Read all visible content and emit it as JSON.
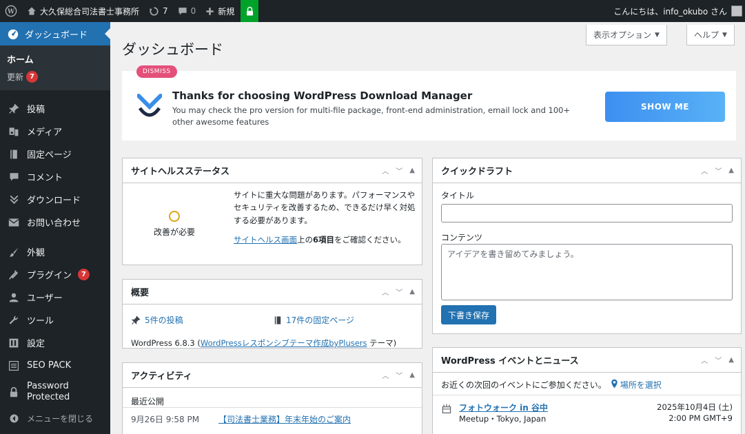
{
  "adminbar": {
    "site_name": "大久保総合司法書士事務所",
    "updates_count": "7",
    "comments_count": "0",
    "new_label": "新規",
    "greeting": "こんにちは、info_okubo さん"
  },
  "sidebar": {
    "current": "ダッシュボード",
    "submenu": [
      {
        "label": "ホーム"
      },
      {
        "label": "更新",
        "badge": "7"
      }
    ],
    "items": [
      {
        "label": "投稿",
        "icon": "pin-icon"
      },
      {
        "label": "メディア",
        "icon": "media-icon"
      },
      {
        "label": "固定ページ",
        "icon": "page-icon"
      },
      {
        "label": "コメント",
        "icon": "comment-icon"
      },
      {
        "label": "ダウンロード",
        "icon": "download-icon"
      },
      {
        "label": "お問い合わせ",
        "icon": "mail-icon"
      },
      {
        "label": "外観",
        "icon": "brush-icon"
      },
      {
        "label": "プラグイン",
        "icon": "plugin-icon",
        "badge": "7"
      },
      {
        "label": "ユーザー",
        "icon": "users-icon"
      },
      {
        "label": "ツール",
        "icon": "wrench-icon"
      },
      {
        "label": "設定",
        "icon": "settings-icon"
      },
      {
        "label": "SEO PACK",
        "icon": "list-icon"
      },
      {
        "label": "Password Protected",
        "icon": "lock-icon"
      },
      {
        "label": "メニューを閉じる",
        "icon": "collapse-icon"
      }
    ]
  },
  "header": {
    "title": "ダッシュボード",
    "screen_options": "表示オプション",
    "help": "ヘルプ"
  },
  "notice": {
    "dismiss": "DISMISS",
    "title": "Thanks for choosing WordPress Download Manager",
    "text": "You may check the pro version for multi-file package, front-end administration, email lock and 100+ other awesome features",
    "button": "SHOW ME"
  },
  "site_health": {
    "title": "サイトヘルスステータス",
    "status": "改善が必要",
    "description": "サイトに重大な問題があります。パフォーマンスやセキュリティを改善するため、できるだけ早く対処する必要があります。",
    "link_text": "サイトヘルス画面",
    "link_suffix_pre": "上の",
    "count_text": "6項目",
    "link_suffix_post": "をご確認ください。"
  },
  "glance": {
    "title": "概要",
    "posts": "5件の投稿",
    "pages": "17件の固定ページ",
    "version_prefix": "WordPress 6.8.3 (",
    "theme_link": "WordPressレスポンシブテーマ作成byPlusers",
    "version_suffix": " テーマ)"
  },
  "activity": {
    "title": "アクティビティ",
    "subtitle": "最近公開",
    "items": [
      {
        "date": "9月26日 9:58 PM",
        "title": "【司法書士業務】年末年始のご案内"
      }
    ]
  },
  "quick_draft": {
    "title": "クイックドラフト",
    "title_label": "タイトル",
    "content_label": "コンテンツ",
    "content_placeholder": "アイデアを書き留めてみましょう。",
    "save": "下書き保存"
  },
  "events": {
    "title": "WordPress イベントとニュース",
    "intro": "お近くの次回のイベントにご参加ください。",
    "select_location": "場所を選択",
    "items": [
      {
        "name": "フォトウォーク in 谷中",
        "meta": "Meetup・Tokyo, Japan",
        "date": "2025年10月4日 (土)",
        "time": "2:00 PM GMT+9"
      }
    ]
  },
  "colors": {
    "admin_dark": "#1d2327",
    "accent": "#2271b1",
    "badge": "#d63638",
    "dismiss": "#e4507a"
  }
}
